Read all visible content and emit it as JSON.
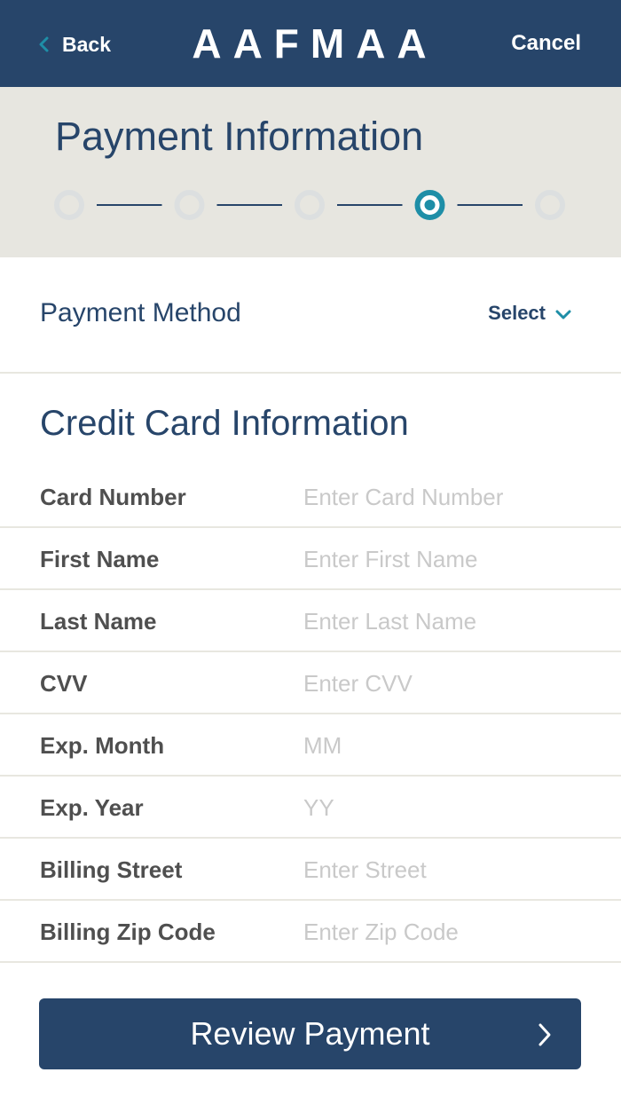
{
  "navbar": {
    "back_label": "Back",
    "brand": "AAFMAA",
    "cancel_label": "Cancel"
  },
  "header": {
    "title": "Payment Information",
    "steps_total": 5,
    "current_step": 4
  },
  "payment_method": {
    "label": "Payment Method",
    "select_label": "Select"
  },
  "credit_card": {
    "section_title": "Credit Card Information",
    "fields": [
      {
        "label": "Card Number",
        "placeholder": "Enter Card Number",
        "value": ""
      },
      {
        "label": "First Name",
        "placeholder": "Enter First Name",
        "value": ""
      },
      {
        "label": "Last Name",
        "placeholder": "Enter Last Name",
        "value": ""
      },
      {
        "label": "CVV",
        "placeholder": "Enter CVV",
        "value": ""
      },
      {
        "label": "Exp. Month",
        "placeholder": "MM",
        "value": ""
      },
      {
        "label": "Exp. Year",
        "placeholder": "YY",
        "value": ""
      },
      {
        "label": "Billing Street",
        "placeholder": "Enter Street",
        "value": ""
      },
      {
        "label": "Billing Zip Code",
        "placeholder": "Enter Zip Code",
        "value": ""
      }
    ]
  },
  "footer": {
    "review_label": "Review Payment"
  },
  "icons": {
    "back": "chevron-left-icon",
    "select": "chevron-down-icon",
    "review": "chevron-right-icon"
  },
  "colors": {
    "navy": "#27456a",
    "teal_accent": "#1e8ea7",
    "header_band": "#e7e6e0",
    "step_inactive": "#dcdfe0",
    "placeholder": "#c9c9c9",
    "label_gray": "#4f4f4f"
  }
}
